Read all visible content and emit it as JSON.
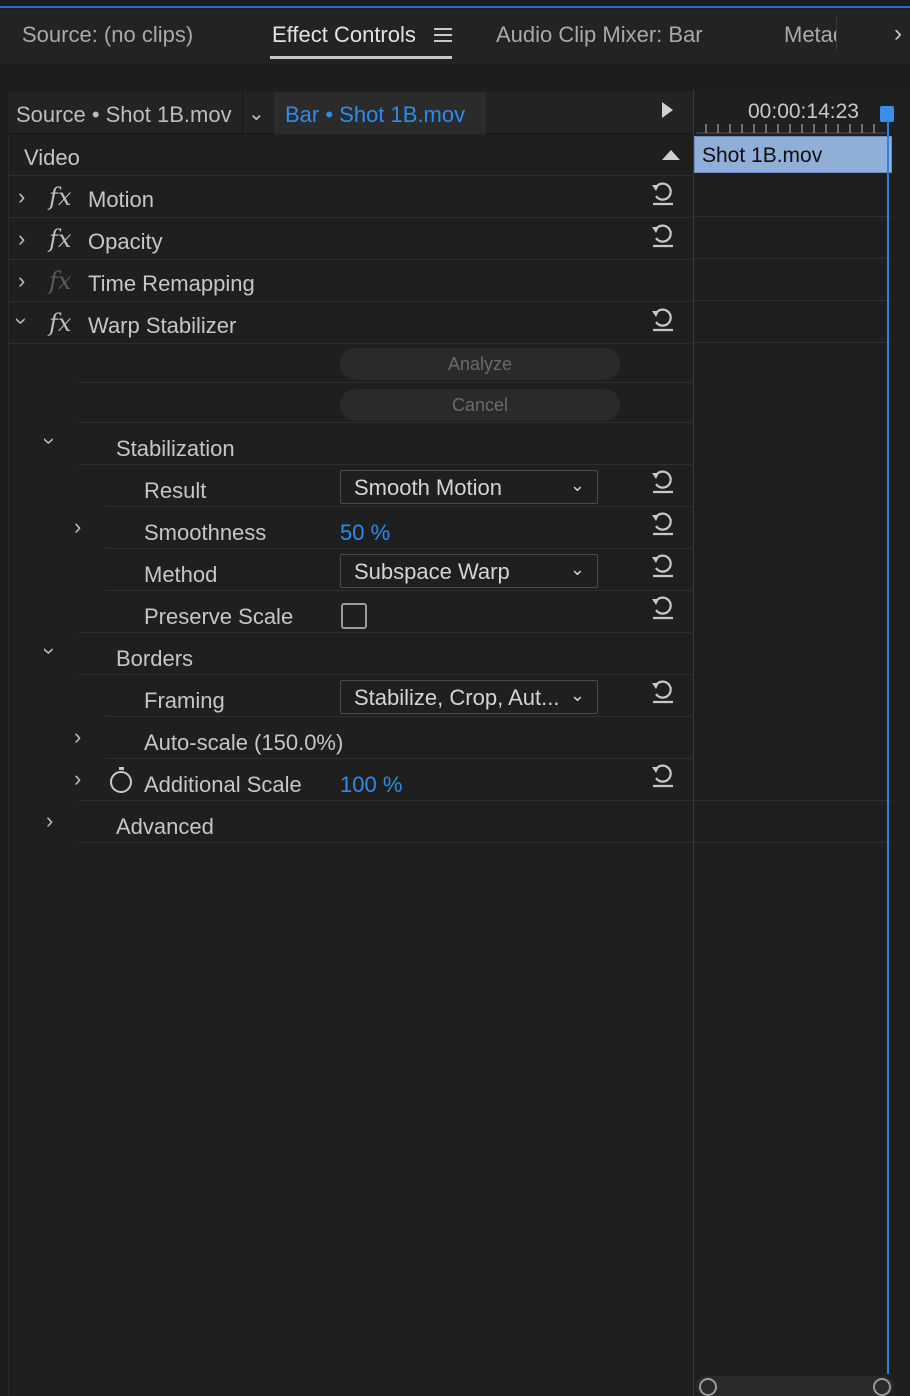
{
  "tabs": {
    "source": "Source: (no clips)",
    "effect_controls": "Effect Controls",
    "audio_mixer": "Audio Clip Mixer: Bar",
    "metadata": "Metad"
  },
  "header": {
    "source_master": "Source • Shot 1B.mov",
    "clip_instance": "Bar • Shot 1B.mov"
  },
  "timeline": {
    "timecode": "00:00:14:23",
    "clip_name": "Shot 1B.mov"
  },
  "video_section": "Video",
  "effects": {
    "motion": "Motion",
    "opacity": "Opacity",
    "time_remapping": "Time Remapping",
    "warp_stabilizer": "Warp Stabilizer"
  },
  "warp": {
    "analyze": "Analyze",
    "cancel": "Cancel",
    "stabilization": "Stabilization",
    "result_label": "Result",
    "result_value": "Smooth Motion",
    "smoothness_label": "Smoothness",
    "smoothness_value": "50 %",
    "method_label": "Method",
    "method_value": "Subspace Warp",
    "preserve_scale_label": "Preserve Scale",
    "preserve_scale_checked": false,
    "borders": "Borders",
    "framing_label": "Framing",
    "framing_value": "Stabilize, Crop, Aut...",
    "autoscale_label": "Auto-scale (150.0%)",
    "additional_scale_label": "Additional Scale",
    "additional_scale_value": "100 %",
    "advanced": "Advanced"
  },
  "colors": {
    "accent_blue": "#2d8ceb",
    "clip_bar": "#8faed8",
    "background": "#1f1f1f"
  }
}
